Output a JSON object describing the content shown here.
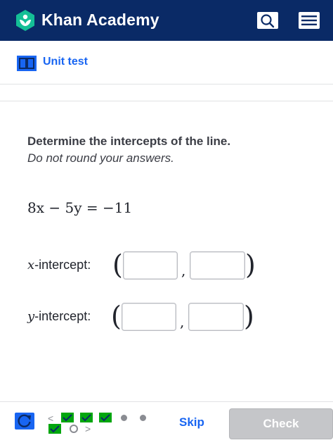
{
  "header": {
    "brand": "Khan Academy",
    "logo_icon": "khan-leaf-icon",
    "search_icon": "search-icon",
    "menu_icon": "hamburger-menu-icon",
    "bg_color": "#0a2a66"
  },
  "breadcrumb": {
    "label": "Unit test",
    "icon": "book-icon",
    "accent": "#1865f2"
  },
  "question": {
    "prompt": "Determine the intercepts of the line.",
    "instruction": "Do not round your answers.",
    "equation": "8x − 5y = −11",
    "x_intercept_label": "x",
    "x_intercept_suffix": "-intercept:",
    "y_intercept_label": "y",
    "y_intercept_suffix": "-intercept:",
    "x_answer": [
      "",
      ""
    ],
    "y_answer": [
      "",
      ""
    ]
  },
  "footer": {
    "restart_icon": "restart-icon",
    "progress": [
      "correct",
      "correct",
      "correct",
      "correct",
      "pending",
      "pending",
      "current"
    ],
    "skip_label": "Skip",
    "check_label": "Check"
  }
}
